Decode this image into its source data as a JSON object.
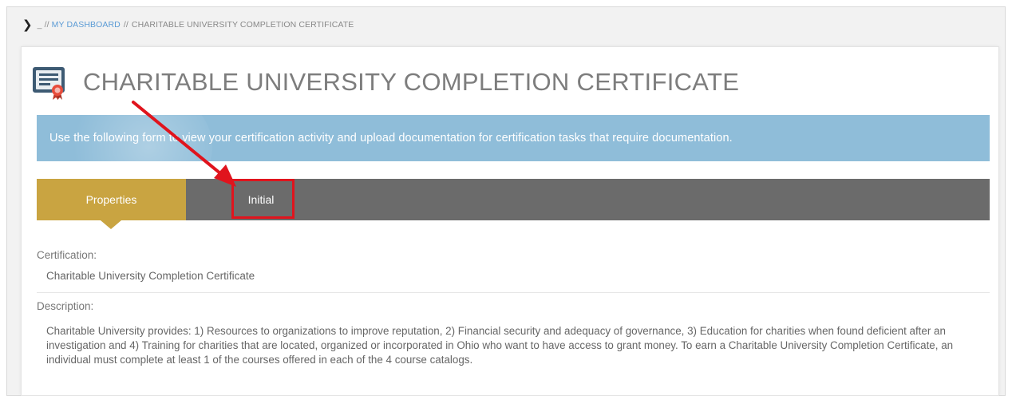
{
  "breadcrumb": {
    "prefix": "_ //",
    "dashboard_link": "MY DASHBOARD",
    "separator": "//",
    "current": "CHARITABLE UNIVERSITY COMPLETION CERTIFICATE"
  },
  "header": {
    "title": "CHARITABLE UNIVERSITY COMPLETION CERTIFICATE",
    "icon": "certificate-icon"
  },
  "banner": {
    "text": "Use the following form to view your certification activity and upload documentation for certification tasks that require documentation."
  },
  "tabs": [
    {
      "label": "Properties",
      "active": true
    },
    {
      "label": "Initial",
      "active": false
    }
  ],
  "fields": {
    "certification_label": "Certification:",
    "certification_value": "Charitable University Completion Certificate",
    "description_label": "Description:",
    "description_value": "Charitable University provides: 1) Resources to organizations to improve reputation, 2) Financial security and adequacy of governance, 3) Education for charities when found deficient after an investigation and 4) Training for charities that are located, organized or incorporated in Ohio who want to have access to grant money. To earn a Charitable University Completion Certificate, an individual must complete at least 1 of the courses offered in each of the 4 course catalogs."
  },
  "colors": {
    "tab_active": "#c9a441",
    "tab_bar": "#6b6b6b",
    "banner": "#8fbdd9",
    "annotation": "#e0141d",
    "link": "#5b9bd5"
  }
}
